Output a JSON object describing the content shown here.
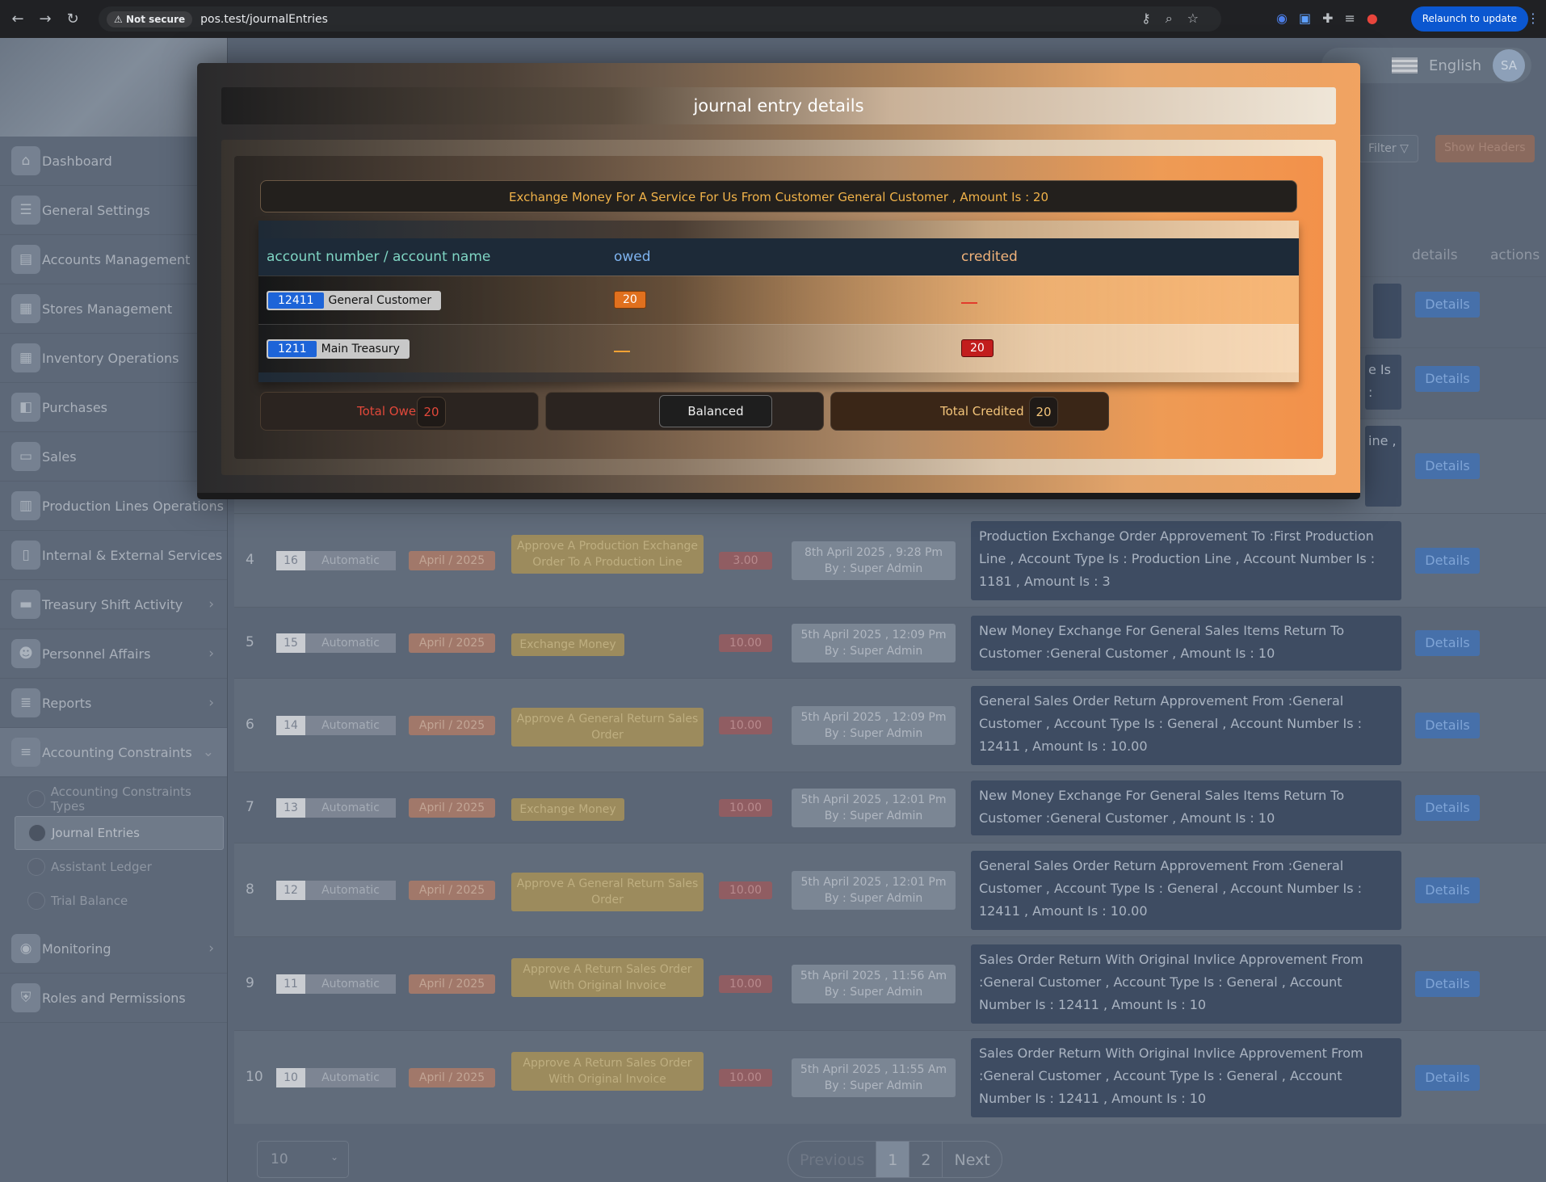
{
  "browser": {
    "not_secure": "Not secure",
    "url": "pos.test/journalEntries",
    "relaunch": "Relaunch to update"
  },
  "topbar": {
    "language": "English",
    "avatar": "SA"
  },
  "sidebar": {
    "items": [
      {
        "label": "Dashboard",
        "icon": "home-icon"
      },
      {
        "label": "General Settings",
        "icon": "settings-icon"
      },
      {
        "label": "Accounts Management",
        "icon": "wallet-icon"
      },
      {
        "label": "Stores Management",
        "icon": "building-icon"
      },
      {
        "label": "Inventory Operations",
        "icon": "building-icon"
      },
      {
        "label": "Purchases",
        "icon": "bag-icon"
      },
      {
        "label": "Sales",
        "icon": "cart-icon"
      },
      {
        "label": "Production Lines Operations",
        "icon": "factory-icon"
      },
      {
        "label": "Internal & External Services",
        "icon": "document-icon"
      },
      {
        "label": "Treasury Shift Activity",
        "icon": "treasury-icon"
      },
      {
        "label": "Personnel Affairs",
        "icon": "people-icon"
      },
      {
        "label": "Reports",
        "icon": "report-icon"
      },
      {
        "label": "Accounting Constraints",
        "icon": "list-icon"
      }
    ],
    "subitems": [
      "Accounting Constraints Types",
      "Journal Entries",
      "Assistant Ledger",
      "Trial Balance"
    ],
    "bottom_items": [
      {
        "label": "Monitoring",
        "icon": "monitor-icon"
      },
      {
        "label": "Roles and Permissions",
        "icon": "shield-icon"
      }
    ]
  },
  "toolbar": {
    "filter": "Filter",
    "show_headers": "Show Headers"
  },
  "table": {
    "headers": {
      "details": "details",
      "actions": "actions"
    },
    "partial": {
      "row2": "e Is :",
      "row3": "ine ,"
    },
    "details_btn": "Details",
    "rows": [
      {
        "n": "4",
        "id": "16",
        "type": "Automatic",
        "date": "April / 2025",
        "kind": "Approve A Production Exchange Order To A Production Line",
        "amount": "3.00",
        "when": "8th April 2025 , 9:28 Pm",
        "by": "By : Super Admin",
        "desc": "Production Exchange Order Approvement To :First Production Line , Account Type Is : Production Line , Account Number Is : 1181 , Amount Is : 3"
      },
      {
        "n": "5",
        "id": "15",
        "type": "Automatic",
        "date": "April / 2025",
        "kind": "Exchange Money",
        "amount": "10.00",
        "when": "5th April 2025 , 12:09 Pm",
        "by": "By : Super Admin",
        "desc": "New Money Exchange For General Sales Items Return To Customer :General Customer , Amount Is : 10"
      },
      {
        "n": "6",
        "id": "14",
        "type": "Automatic",
        "date": "April / 2025",
        "kind": "Approve A General Return Sales Order",
        "amount": "10.00",
        "when": "5th April 2025 , 12:09 Pm",
        "by": "By : Super Admin",
        "desc": "General Sales Order Return Approvement From :General Customer , Account Type Is : General , Account Number Is : 12411 , Amount Is : 10.00"
      },
      {
        "n": "7",
        "id": "13",
        "type": "Automatic",
        "date": "April / 2025",
        "kind": "Exchange Money",
        "amount": "10.00",
        "when": "5th April 2025 , 12:01 Pm",
        "by": "By : Super Admin",
        "desc": "New Money Exchange For General Sales Items Return To Customer :General Customer , Amount Is : 10"
      },
      {
        "n": "8",
        "id": "12",
        "type": "Automatic",
        "date": "April / 2025",
        "kind": "Approve A General Return Sales Order",
        "amount": "10.00",
        "when": "5th April 2025 , 12:01 Pm",
        "by": "By : Super Admin",
        "desc": "General Sales Order Return Approvement From :General Customer , Account Type Is : General , Account Number Is : 12411 , Amount Is : 10.00"
      },
      {
        "n": "9",
        "id": "11",
        "type": "Automatic",
        "date": "April / 2025",
        "kind": "Approve A Return Sales Order With Original Invoice",
        "amount": "10.00",
        "when": "5th April 2025 , 11:56 Am",
        "by": "By : Super Admin",
        "desc": "Sales Order Return With Original Invlice Approvement From :General Customer , Account Type Is : General , Account Number Is : 12411 , Amount Is : 10"
      },
      {
        "n": "10",
        "id": "10",
        "type": "Automatic",
        "date": "April / 2025",
        "kind": "Approve A Return Sales Order With Original Invoice",
        "amount": "10.00",
        "when": "5th April 2025 , 11:55 Am",
        "by": "By : Super Admin",
        "desc": "Sales Order Return With Original Invlice Approvement From :General Customer , Account Type Is : General , Account Number Is : 12411 , Amount Is : 10"
      }
    ]
  },
  "pagination": {
    "per_page": "10",
    "previous": "Previous",
    "pages": [
      "1",
      "2"
    ],
    "next": "Next"
  },
  "modal": {
    "title": "journal entry details",
    "description": "Exchange Money For A Service For Us From Customer General Customer , Amount Is : 20",
    "col_account": "account number / account name",
    "col_owed": "owed",
    "col_credited": "credited",
    "lines": [
      {
        "number": "12411",
        "name": "General Customer",
        "owed": "20",
        "credited": ""
      },
      {
        "number": "1211",
        "name": "Main Treasury",
        "owed": "",
        "credited": "20"
      }
    ],
    "total_owed_label": "Total Owed :",
    "total_owed": "20",
    "balanced": "Balanced",
    "total_credited_label": "Total Credited :",
    "total_credited": "20"
  },
  "colors": {
    "accent_orange": "#f3914a",
    "details_blue": "#4670aa",
    "owed_badge": "#e0701e",
    "credit_badge": "#c21d1d"
  }
}
